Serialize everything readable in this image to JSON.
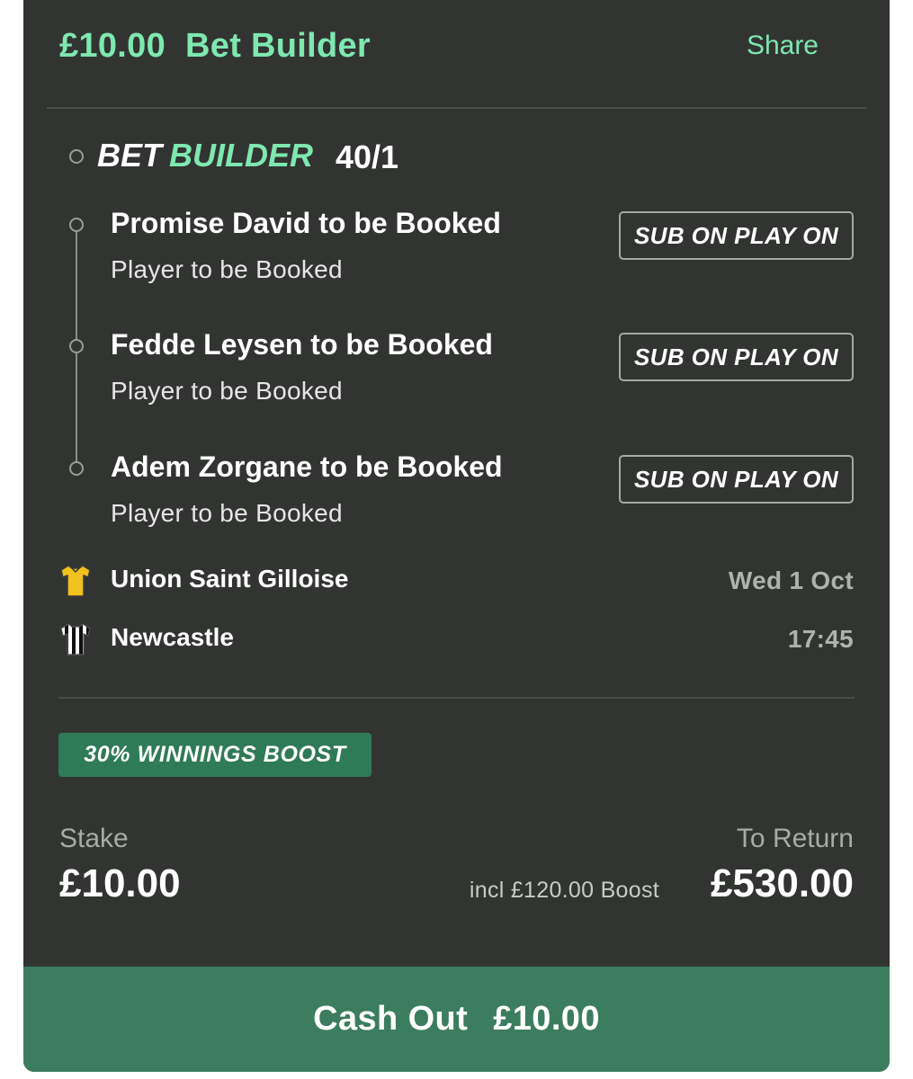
{
  "header": {
    "amount": "£10.00",
    "title": "Bet Builder",
    "share_label": "Share"
  },
  "bet_builder": {
    "label_part1": "BET",
    "label_part2": "BUILDER",
    "odds": "40/1"
  },
  "selections": [
    {
      "name": "Promise David to be Booked",
      "market": "Player to be Booked",
      "badge": "SUB ON PLAY ON"
    },
    {
      "name": "Fedde Leysen to be Booked",
      "market": "Player to be Booked",
      "badge": "SUB ON PLAY ON"
    },
    {
      "name": "Adem Zorgane to be Booked",
      "market": "Player to be Booked",
      "badge": "SUB ON PLAY ON"
    }
  ],
  "event": {
    "home_team": "Union Saint Gilloise",
    "away_team": "Newcastle",
    "date": "Wed 1 Oct",
    "time": "17:45",
    "home_shirt_icon": "yellow-shirt-icon",
    "away_shirt_icon": "striped-shirt-icon"
  },
  "promo": {
    "boost_label": "30% WINNINGS BOOST"
  },
  "summary": {
    "stake_label": "Stake",
    "stake_value": "£10.00",
    "return_label": "To Return",
    "return_value": "£530.00",
    "boost_included": "incl £120.00 Boost"
  },
  "cashout": {
    "label": "Cash Out",
    "amount": "£10.00"
  },
  "colors": {
    "background": "#323432",
    "accent": "#7ee8b0",
    "button": "#3b7d5e",
    "boost_badge": "#2f7a57"
  }
}
